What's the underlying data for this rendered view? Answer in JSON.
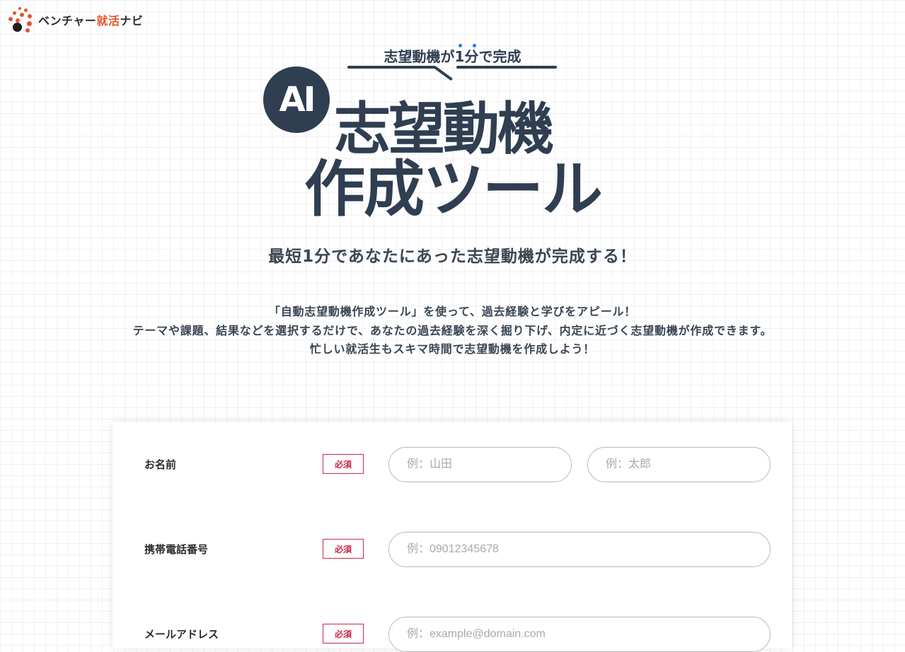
{
  "header": {
    "logo_text_a": "ベンチャー",
    "logo_text_b": "就活",
    "logo_text_c": "ナビ",
    "brand_color": "#e2542a"
  },
  "hero": {
    "catch": "志望動機が1分で完成",
    "ai_badge": "AI",
    "title_line1": "志望動機",
    "title_line2": "作成ツール"
  },
  "subtitle": "最短1分であなたにあった志望動機が完成する！",
  "description": {
    "line1": "「自動志望動機作成ツール」を使って、過去経験と学びをアピール！",
    "line2": "テーマや課題、結果などを選択するだけで、あなたの過去経験を深く掘り下げ、内定に近づく志望動機が作成できます。",
    "line3": "忙しい就活生もスキマ時間で志望動機を作成しよう！"
  },
  "form": {
    "required_label": "必須",
    "required_color": "#c8294b",
    "name": {
      "label": "お名前",
      "last_placeholder": "例：山田",
      "first_placeholder": "例：太郎",
      "last_value": "",
      "first_value": ""
    },
    "phone": {
      "label": "携帯電話番号",
      "placeholder": "例：09012345678",
      "value": ""
    },
    "email": {
      "label": "メールアドレス",
      "placeholder": "例：example@domain.com",
      "value": ""
    }
  }
}
